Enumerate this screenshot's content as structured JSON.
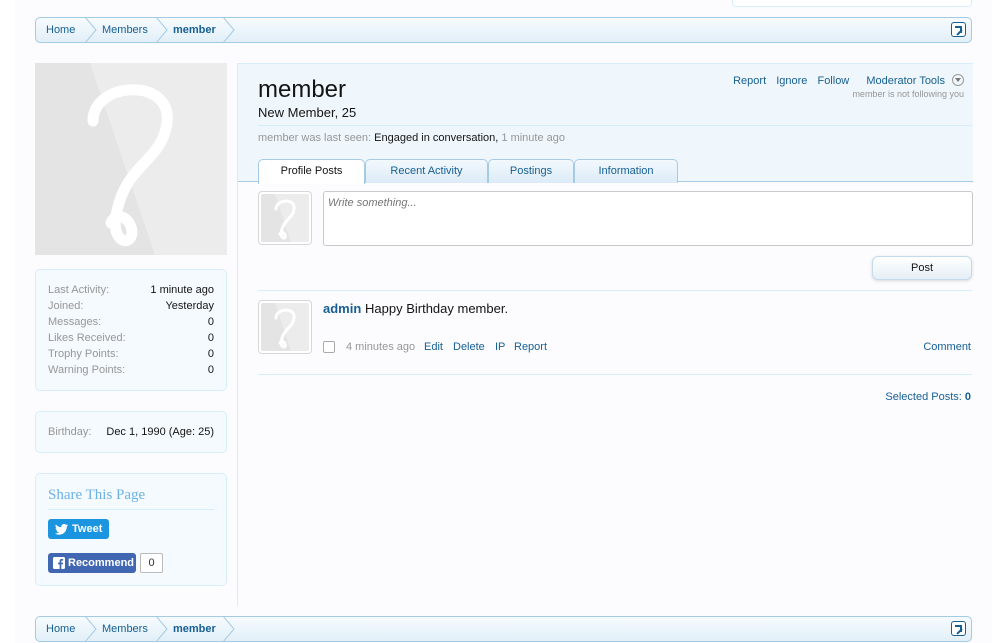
{
  "breadcrumb": {
    "items": [
      "Home",
      "Members",
      "member"
    ]
  },
  "sidebar": {
    "stats": [
      {
        "label": "Last Activity:",
        "value": "1 minute ago"
      },
      {
        "label": "Joined:",
        "value": "Yesterday"
      },
      {
        "label": "Messages:",
        "value": "0"
      },
      {
        "label": "Likes Received:",
        "value": "0"
      },
      {
        "label": "Trophy Points:",
        "value": "0"
      },
      {
        "label": "Warning Points:",
        "value": "0"
      }
    ],
    "birthday": {
      "label": "Birthday:",
      "value": "Dec 1, 1990 (Age: 25)"
    },
    "share": {
      "title": "Share This Page",
      "tweet_label": "Tweet",
      "recommend_label": "Recommend",
      "recommend_count": "0"
    }
  },
  "profile": {
    "username": "member",
    "user_title": "New Member, 25",
    "last_seen_prefix": "member was last seen:",
    "last_seen_activity": "Engaged in conversation,",
    "last_seen_time": "1 minute ago",
    "actions": {
      "report": "Report",
      "ignore": "Ignore",
      "follow": "Follow",
      "moderator_tools": "Moderator Tools"
    },
    "not_following": "member is not following you"
  },
  "tabs": [
    "Profile Posts",
    "Recent Activity",
    "Postings",
    "Information"
  ],
  "composer": {
    "placeholder": "Write something...",
    "post_label": "Post"
  },
  "message": {
    "poster": "admin",
    "text": "Happy Birthday member.",
    "time": "4 minutes ago",
    "edit": "Edit",
    "delete": "Delete",
    "ip": "IP",
    "report": "Report",
    "comment": "Comment"
  },
  "selected_posts": {
    "label": "Selected Posts:",
    "count": "0"
  },
  "colors": {
    "link": "#176093",
    "border": "#a5cae4",
    "muted": "#969696",
    "share_title": "#6cb2e4"
  }
}
